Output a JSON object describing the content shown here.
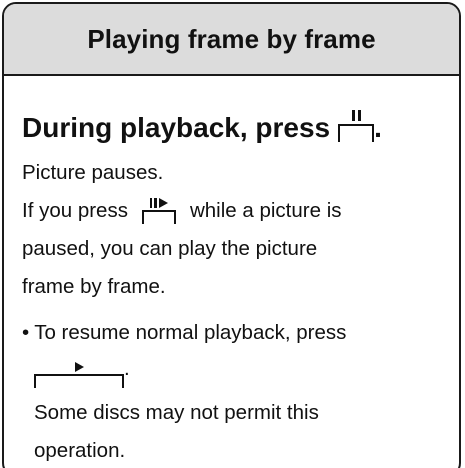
{
  "header": {
    "title": "Playing frame by frame"
  },
  "step": {
    "text": "During playback, press",
    "end": ".",
    "button_icon": "pause-icon"
  },
  "body": {
    "line1": "Picture pauses.",
    "line2_a": "If you press",
    "line2_b": "while a picture is",
    "line2_button_icon": "slow-forward-icon",
    "line3": "paused, you can play the picture",
    "line4": "frame by frame."
  },
  "note": {
    "bullet": "•",
    "text": "To resume normal playback, press",
    "button_icon": "play-icon",
    "end": ".",
    "line2": "Some discs may not permit this",
    "line3": "operation."
  }
}
